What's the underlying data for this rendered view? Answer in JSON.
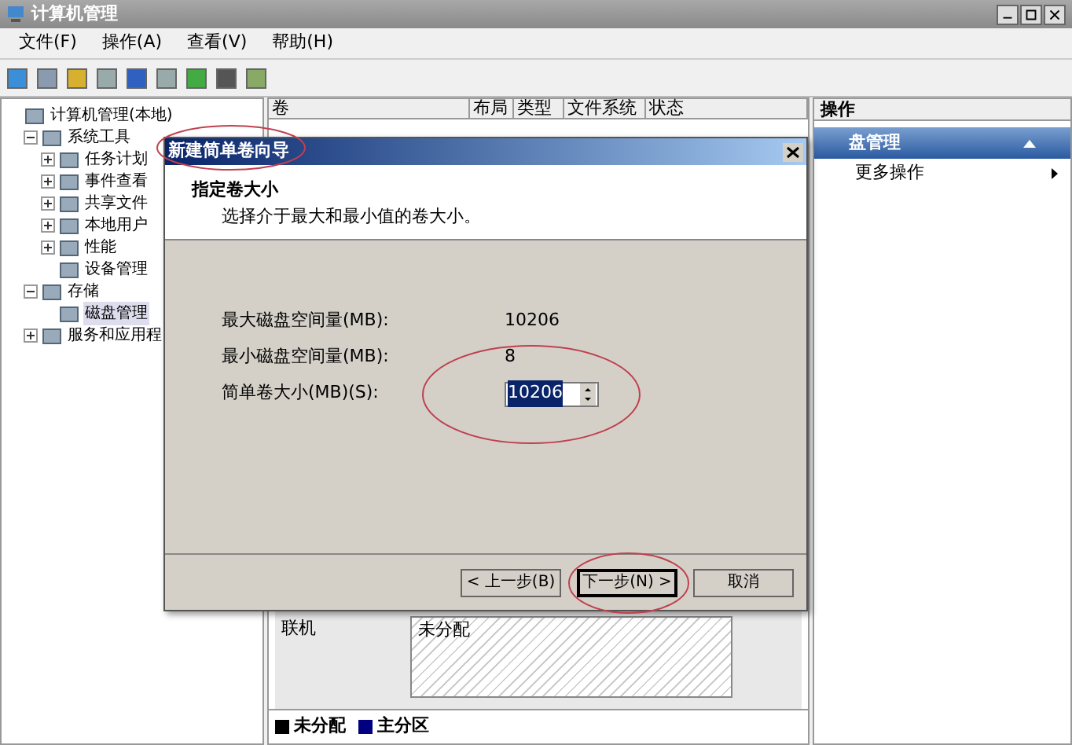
{
  "window": {
    "title": "计算机管理"
  },
  "menu": [
    {
      "label": "文件(F)"
    },
    {
      "label": "操作(A)"
    },
    {
      "label": "查看(V)"
    },
    {
      "label": "帮助(H)"
    }
  ],
  "tree": [
    {
      "label": "计算机管理(本地)",
      "children": [
        {
          "label": "系统工具",
          "expanded": true,
          "children": [
            {
              "label": "任务计划",
              "expanded": false
            },
            {
              "label": "事件查看",
              "expanded": false
            },
            {
              "label": "共享文件",
              "expanded": false
            },
            {
              "label": "本地用户",
              "expanded": false
            },
            {
              "label": "性能",
              "expanded": false
            },
            {
              "label": "设备管理"
            }
          ]
        },
        {
          "label": "存储",
          "expanded": true,
          "children": [
            {
              "label": "磁盘管理",
              "selected": true
            }
          ]
        },
        {
          "label": "服务和应用程",
          "expanded": false
        }
      ]
    }
  ],
  "table": {
    "columns": [
      "卷",
      "布局",
      "类型",
      "文件系统",
      "状态"
    ]
  },
  "disk": {
    "status": "联机",
    "partition": "未分配"
  },
  "legend": [
    {
      "label": "未分配",
      "color": "#000000"
    },
    {
      "label": "主分区",
      "color": "#000080"
    }
  ],
  "actions": {
    "header": "操作",
    "section": "盘管理",
    "expanded": true,
    "items": [
      "更多操作"
    ]
  },
  "dialog": {
    "title": "新建简单卷向导",
    "heading": "指定卷大小",
    "subheading": "选择介于最大和最小值的卷大小。",
    "fields": [
      {
        "kind": "text",
        "label": "最大磁盘空间量(MB):",
        "value": "10206"
      },
      {
        "kind": "text",
        "label": "最小磁盘空间量(MB):",
        "value": "8"
      },
      {
        "kind": "spin",
        "label": "简单卷大小(MB)(S):",
        "value": "10206",
        "selected": true
      }
    ],
    "buttons": [
      {
        "label": "< 上一步(B)",
        "default": false
      },
      {
        "label": "下一步(N) >",
        "default": true
      },
      {
        "label": "取消",
        "default": false
      }
    ]
  }
}
